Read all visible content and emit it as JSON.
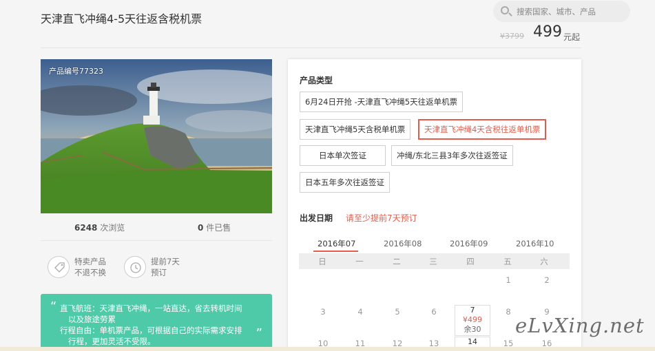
{
  "header": {
    "title": "天津直飞冲绳4-5天往返含税机票",
    "search_placeholder": "搜索国家、城市、产品",
    "price_old": "¥3799",
    "price_now": "499",
    "price_unit": "元起"
  },
  "product": {
    "id_label": "产品编号77323",
    "views_num": "6248",
    "views_label": "次浏览",
    "sold_num": "0",
    "sold_label": "件已售",
    "features": [
      {
        "line1": "特卖产品",
        "line2": "不退不换",
        "icon": "tag-icon"
      },
      {
        "line1": "提前7天",
        "line2": "预订",
        "icon": "clock-icon"
      }
    ],
    "highlights": [
      "直飞航班：天津直飞冲绳，一站直达，省去转机时间",
      "以及旅途劳累",
      "行程自由：单机票产品，可根据自己的实际需求安排",
      "行程，更加灵活不受限。"
    ]
  },
  "booking": {
    "type_title": "产品类型",
    "options": [
      "6月24日开抢 -天津直飞冲绳5天往返单机票",
      "天津直飞冲绳5天含税单机票",
      "天津直飞冲绳4天含税往返单机票",
      "日本单次签证",
      "冲绳/东北三县3年多次往返签证",
      "日本五年多次往返签证"
    ],
    "selected_index": 2,
    "date_title": "出发日期",
    "date_note": "请至少提前7天预订",
    "months": [
      "2016年07",
      "2016年08",
      "2016年09",
      "2016年10"
    ],
    "weekdays": [
      "日",
      "一",
      "二",
      "三",
      "四",
      "五",
      "六"
    ],
    "row1": [
      "1",
      "2"
    ],
    "row2": [
      "3",
      "4",
      "5",
      "6",
      "7",
      "8",
      "9"
    ],
    "row3": [
      "10",
      "11",
      "12",
      "13",
      "14",
      "15",
      "16"
    ],
    "cell_price": "¥499",
    "cell_remaining": "余30"
  },
  "watermark": "eLvXing.net",
  "colors": {
    "accent": "#e55b4b",
    "green": "#4ecaa8"
  }
}
